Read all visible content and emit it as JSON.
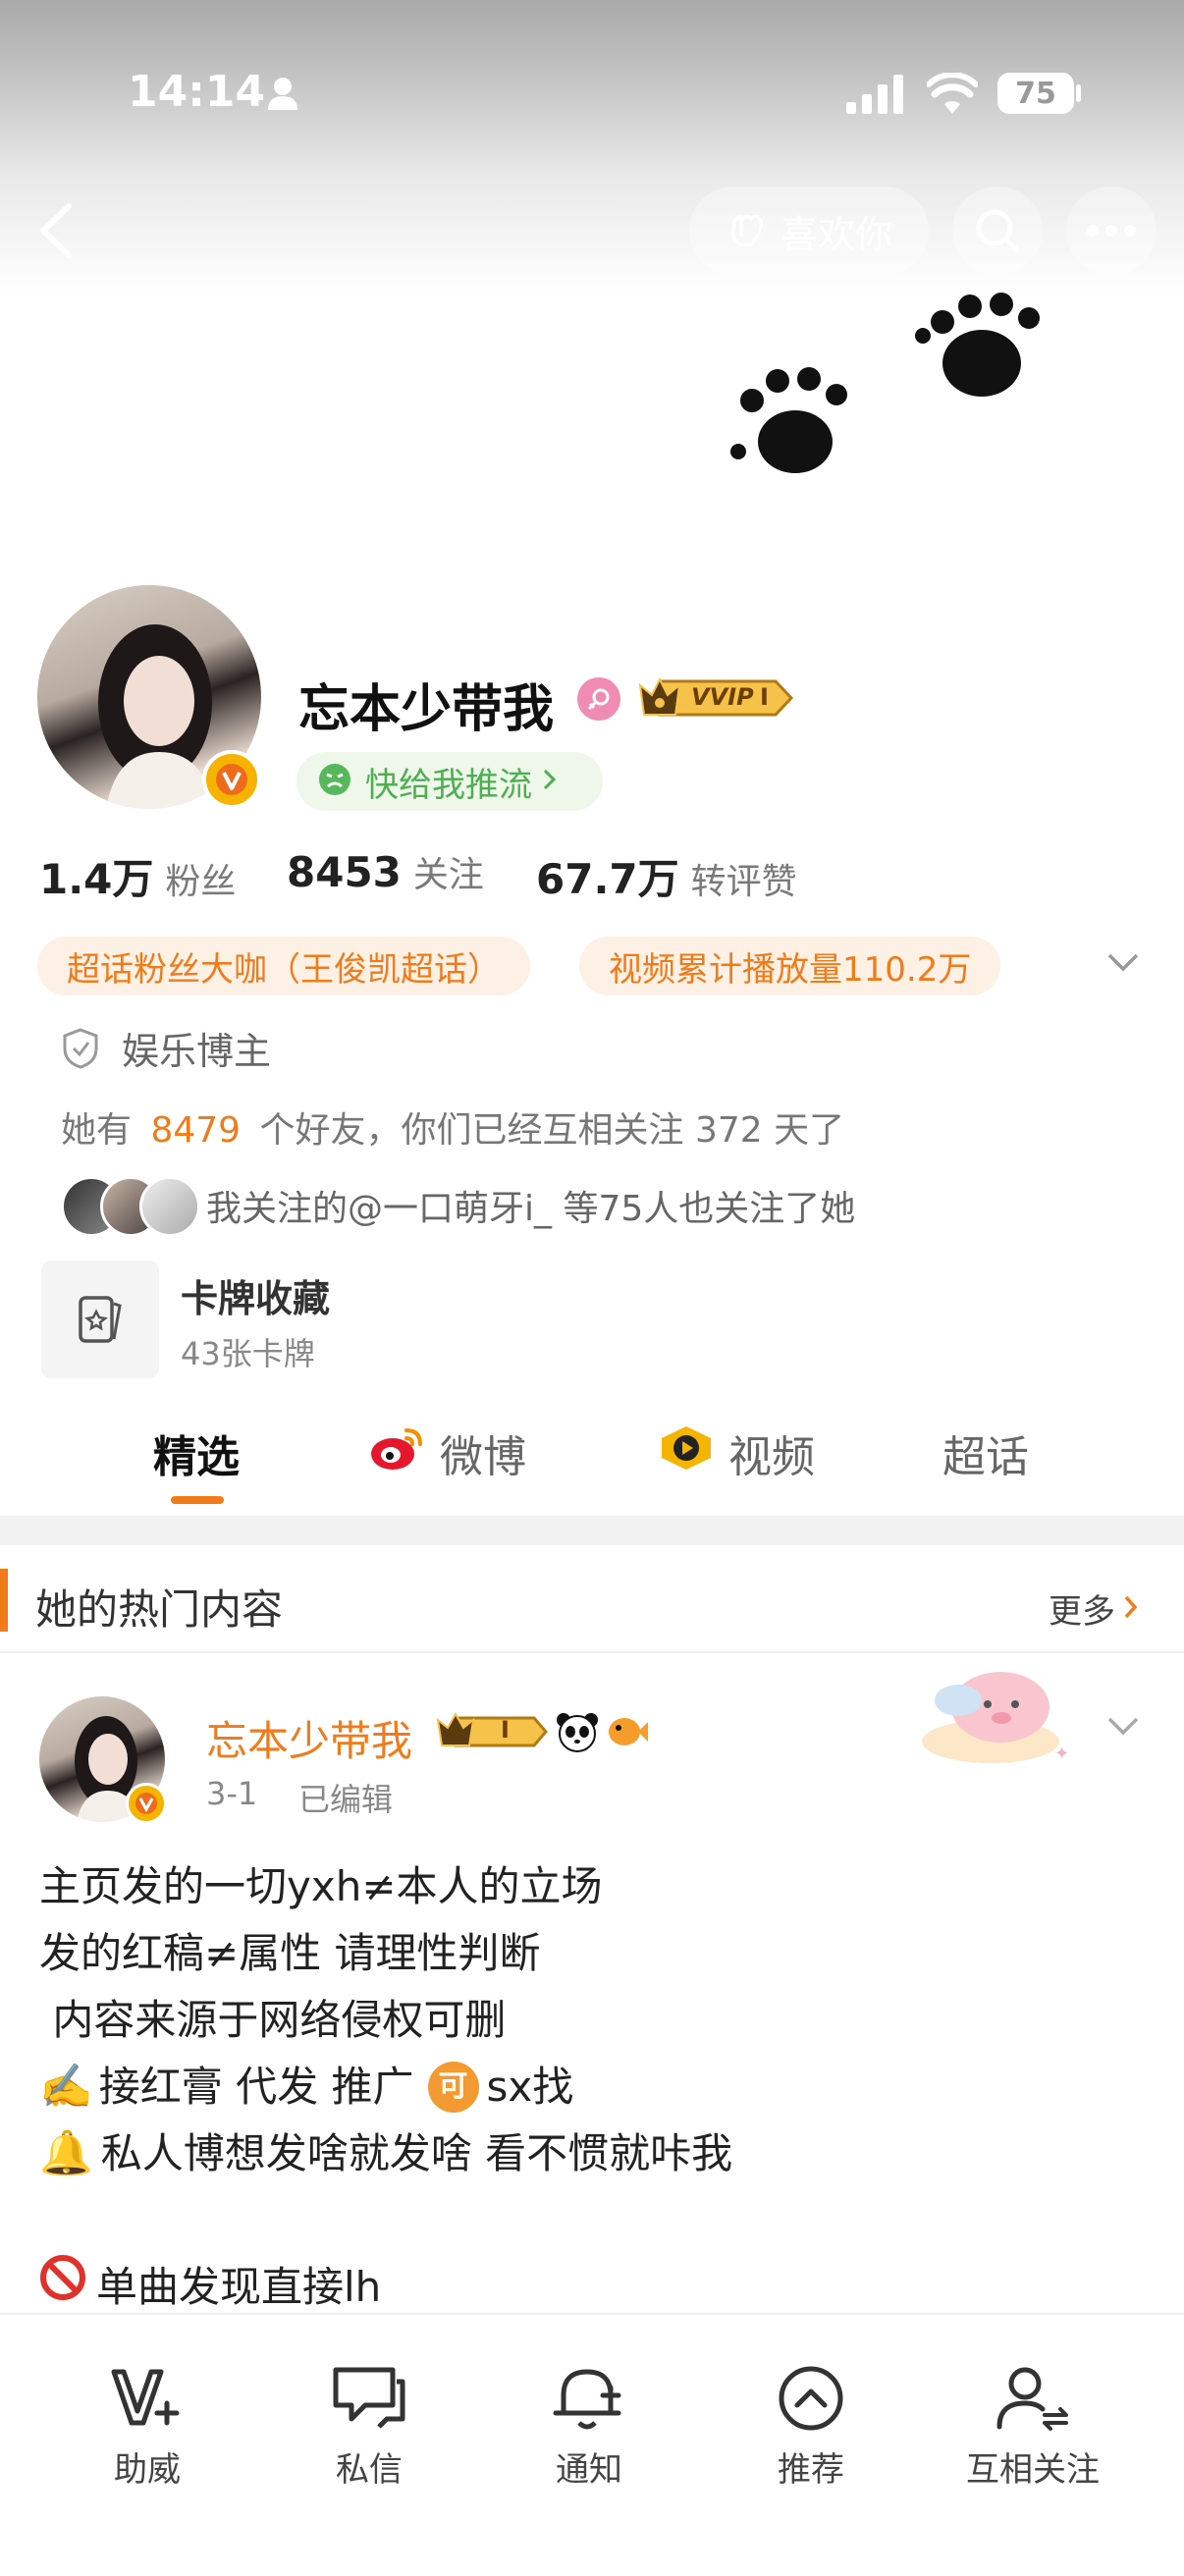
{
  "status_bar": {
    "time": "14:14",
    "battery": "75"
  },
  "top_bar": {
    "like_label": "喜欢你"
  },
  "profile": {
    "name": "忘本少带我",
    "vvip_label": "VVIP",
    "vvip_level": "I",
    "push_label": "快给我推流"
  },
  "stats": [
    {
      "value": "1.4万",
      "label": "粉丝"
    },
    {
      "value": "8453",
      "label": "关注"
    },
    {
      "value": "67.7万",
      "label": "转评赞"
    }
  ],
  "tags": [
    "超话粉丝大咖（王俊凯超话）",
    "视频累计播放量110.2万"
  ],
  "category": "娱乐博主",
  "friends": {
    "prefix": "她有",
    "count": "8479",
    "suffix": "个好友，你们已经互相关注 372 天了"
  },
  "mutual_follow_text": "我关注的@一口萌牙i_ 等75人也关注了她",
  "cards": {
    "title": "卡牌收藏",
    "subtitle": "43张卡牌"
  },
  "tabs": [
    "精选",
    "微博",
    "视频",
    "超话"
  ],
  "hot_section": {
    "title": "她的热门内容",
    "more": "更多"
  },
  "post": {
    "author": "忘本少带我",
    "badge_level": "I",
    "date": "3-1",
    "edited": "已编辑",
    "lines": [
      "主页发的一切yxh≠本人的立场",
      "发的红稿≠属性 请理性判断",
      " 内容来源于网络侵权可删",
      "接红膏 代发 推广",
      "sx找",
      "私人博想发啥就发啥 看不惯就咔我",
      "单曲发现直接lh"
    ],
    "ke_char": "可"
  },
  "bottom_nav": [
    "助威",
    "私信",
    "通知",
    "推荐",
    "互相关注"
  ],
  "colors": {
    "accent": "#f07b1a",
    "green": "#4caf50",
    "text": "#222222",
    "muted": "#7a7a7a"
  }
}
